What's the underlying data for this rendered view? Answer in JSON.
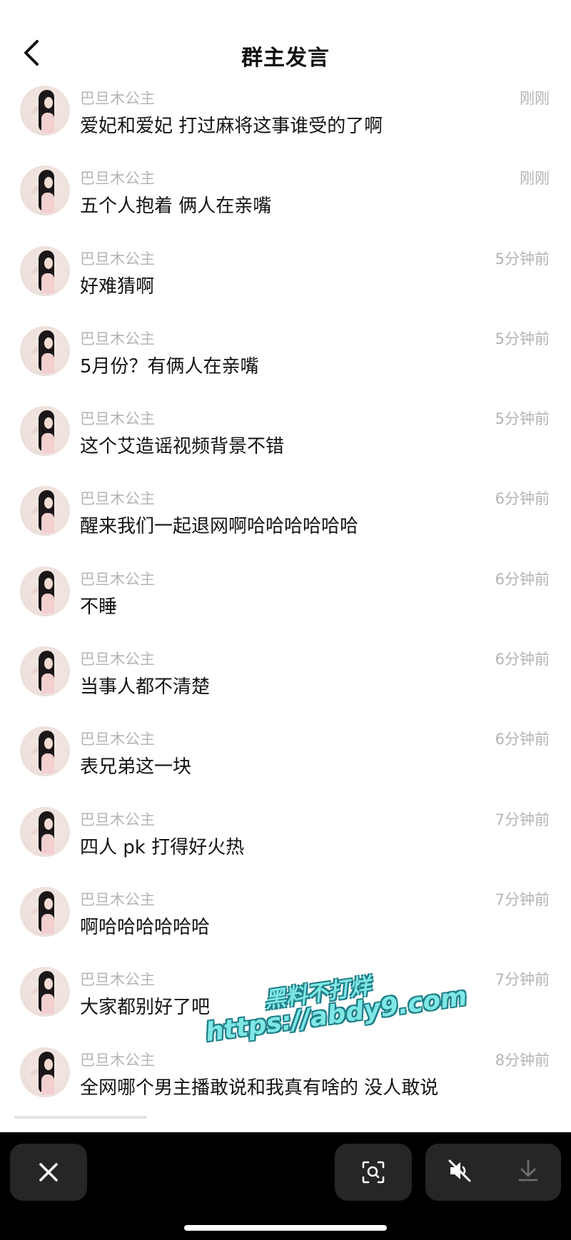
{
  "header": {
    "title": "群主发言"
  },
  "messages": [
    {
      "name": "巴旦木公主",
      "time": "刚刚",
      "text": "爱妃和爱妃 打过麻将这事谁受的了啊"
    },
    {
      "name": "巴旦木公主",
      "time": "刚刚",
      "text": "五个人抱着 俩人在亲嘴"
    },
    {
      "name": "巴旦木公主",
      "time": "5分钟前",
      "text": "好难猜啊"
    },
    {
      "name": "巴旦木公主",
      "time": "5分钟前",
      "text": "5月份？有俩人在亲嘴"
    },
    {
      "name": "巴旦木公主",
      "time": "5分钟前",
      "text": "这个艾造谣视频背景不错"
    },
    {
      "name": "巴旦木公主",
      "time": "6分钟前",
      "text": "醒来我们一起退网啊哈哈哈哈哈哈"
    },
    {
      "name": "巴旦木公主",
      "time": "6分钟前",
      "text": "不睡"
    },
    {
      "name": "巴旦木公主",
      "time": "6分钟前",
      "text": "当事人都不清楚"
    },
    {
      "name": "巴旦木公主",
      "time": "6分钟前",
      "text": "表兄弟这一块"
    },
    {
      "name": "巴旦木公主",
      "time": "7分钟前",
      "text": "四人 pk 打得好火热"
    },
    {
      "name": "巴旦木公主",
      "time": "7分钟前",
      "text": "啊哈哈哈哈哈哈"
    },
    {
      "name": "巴旦木公主",
      "time": "7分钟前",
      "text": "大家都别好了吧"
    },
    {
      "name": "巴旦木公主",
      "time": "8分钟前",
      "text": "全网哪个男主播敢说和我真有啥的 没人敢说"
    }
  ],
  "watermark": {
    "line1": "黑料不打烊",
    "line2": "https://abdy9.com"
  },
  "icons": {
    "back": "chevron-left-icon",
    "close": "close-icon",
    "scan": "scan-search-icon",
    "mute": "speaker-muted-icon",
    "download": "download-icon"
  }
}
